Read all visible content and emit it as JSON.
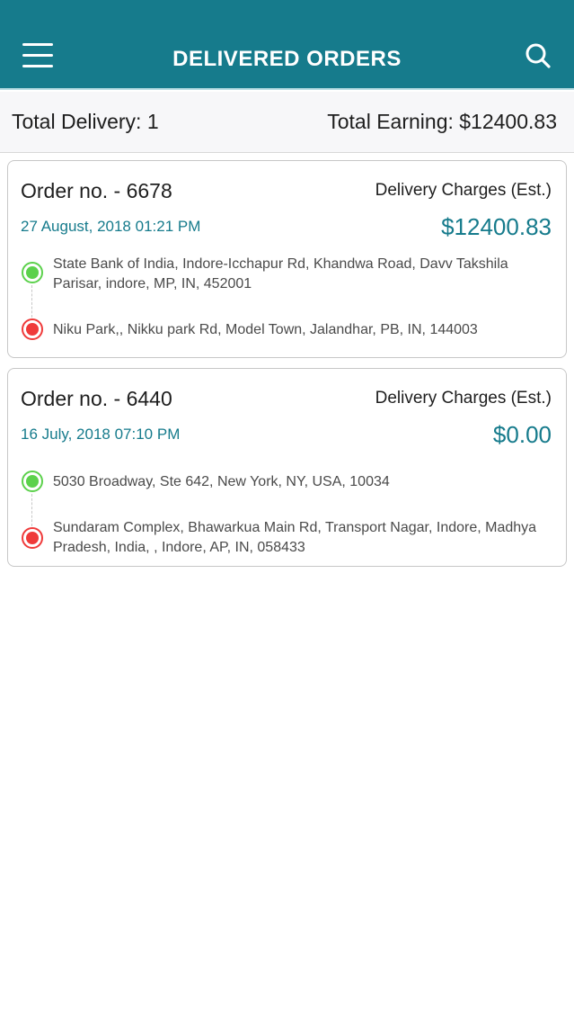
{
  "header": {
    "title": "DELIVERED ORDERS",
    "menu_icon": "hamburger-menu-icon",
    "search_icon": "search-icon",
    "bg_color": "#167b8c"
  },
  "summary": {
    "total_delivery": "Total Delivery: 1",
    "total_earning": "Total Earning: $12400.83"
  },
  "orders": [
    {
      "order_no": "Order no. - 6678",
      "charges_label": "Delivery Charges (Est.)",
      "date": "27 August, 2018 01:21 PM",
      "amount": "$12400.83",
      "pickup": "State Bank of India, Indore-Icchapur Rd, Khandwa Road, Davv Takshila Parisar, indore, MP, IN, 452001",
      "dropoff": "Niku Park,, Nikku park Rd, Model Town, Jalandhar, PB, IN, 144003"
    },
    {
      "order_no": "Order no. - 6440",
      "charges_label": "Delivery Charges (Est.)",
      "date": "16 July, 2018 07:10 PM",
      "amount": "$0.00",
      "pickup": "5030 Broadway, Ste 642, New York, NY, USA, 10034",
      "dropoff": "Sundaram Complex, Bhawarkua Main Rd, Transport Nagar, Indore, Madhya Pradesh, India, , Indore, AP, IN, 058433"
    }
  ],
  "colors": {
    "accent": "#167b8c",
    "pickup_dot": "#5cd14c",
    "dropoff_dot": "#ef3a3a"
  }
}
